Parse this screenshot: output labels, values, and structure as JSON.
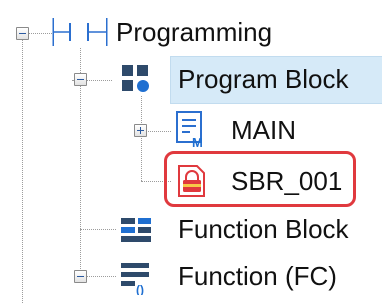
{
  "tree": {
    "root": {
      "label": "Programming",
      "state": "expanded",
      "icon": "ladder-contacts-icon"
    },
    "program_blocks": {
      "label": "Program Block",
      "state": "expanded",
      "selected": true,
      "icon": "program-blocks-icon"
    },
    "main": {
      "label": "MAIN",
      "state": "collapsed",
      "icon": "main-program-icon"
    },
    "sbr": {
      "label": "SBR_001",
      "icon": "locked-subroutine-icon",
      "highlighted": true
    },
    "function_block": {
      "label": "Function Block",
      "icon": "function-block-icon"
    },
    "function_fc": {
      "label": "Function (FC)",
      "state": "expanded",
      "icon": "function-fc-icon"
    }
  },
  "colors": {
    "selection_bg": "#d6eaf8",
    "highlight": "#e0393e",
    "accent_blue": "#1f6fd1"
  }
}
